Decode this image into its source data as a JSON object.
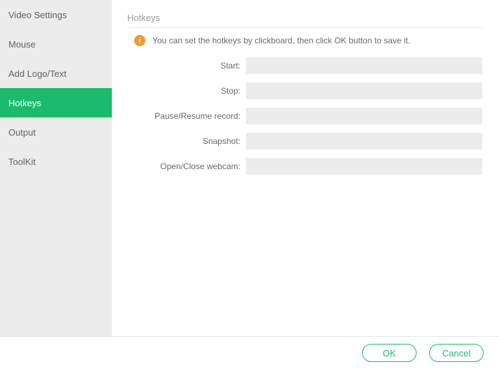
{
  "sidebar": {
    "items": [
      {
        "label": "Video Settings",
        "id": "video-settings"
      },
      {
        "label": "Mouse",
        "id": "mouse"
      },
      {
        "label": "Add Logo/Text",
        "id": "add-logo-text"
      },
      {
        "label": "Hotkeys",
        "id": "hotkeys"
      },
      {
        "label": "Output",
        "id": "output"
      },
      {
        "label": "ToolKit",
        "id": "toolkit"
      }
    ],
    "active_index": 3
  },
  "page": {
    "title": "Hotkeys",
    "hint": "You can set the hotkeys by clickboard, then click OK button to save it."
  },
  "form": {
    "fields": [
      {
        "label": "Start:",
        "value": ""
      },
      {
        "label": "Stop:",
        "value": ""
      },
      {
        "label": "Pause/Resume record:",
        "value": ""
      },
      {
        "label": "Snapshot:",
        "value": ""
      },
      {
        "label": "Open/Close webcam:",
        "value": ""
      }
    ]
  },
  "footer": {
    "ok_label": "OK",
    "cancel_label": "Cancel"
  }
}
